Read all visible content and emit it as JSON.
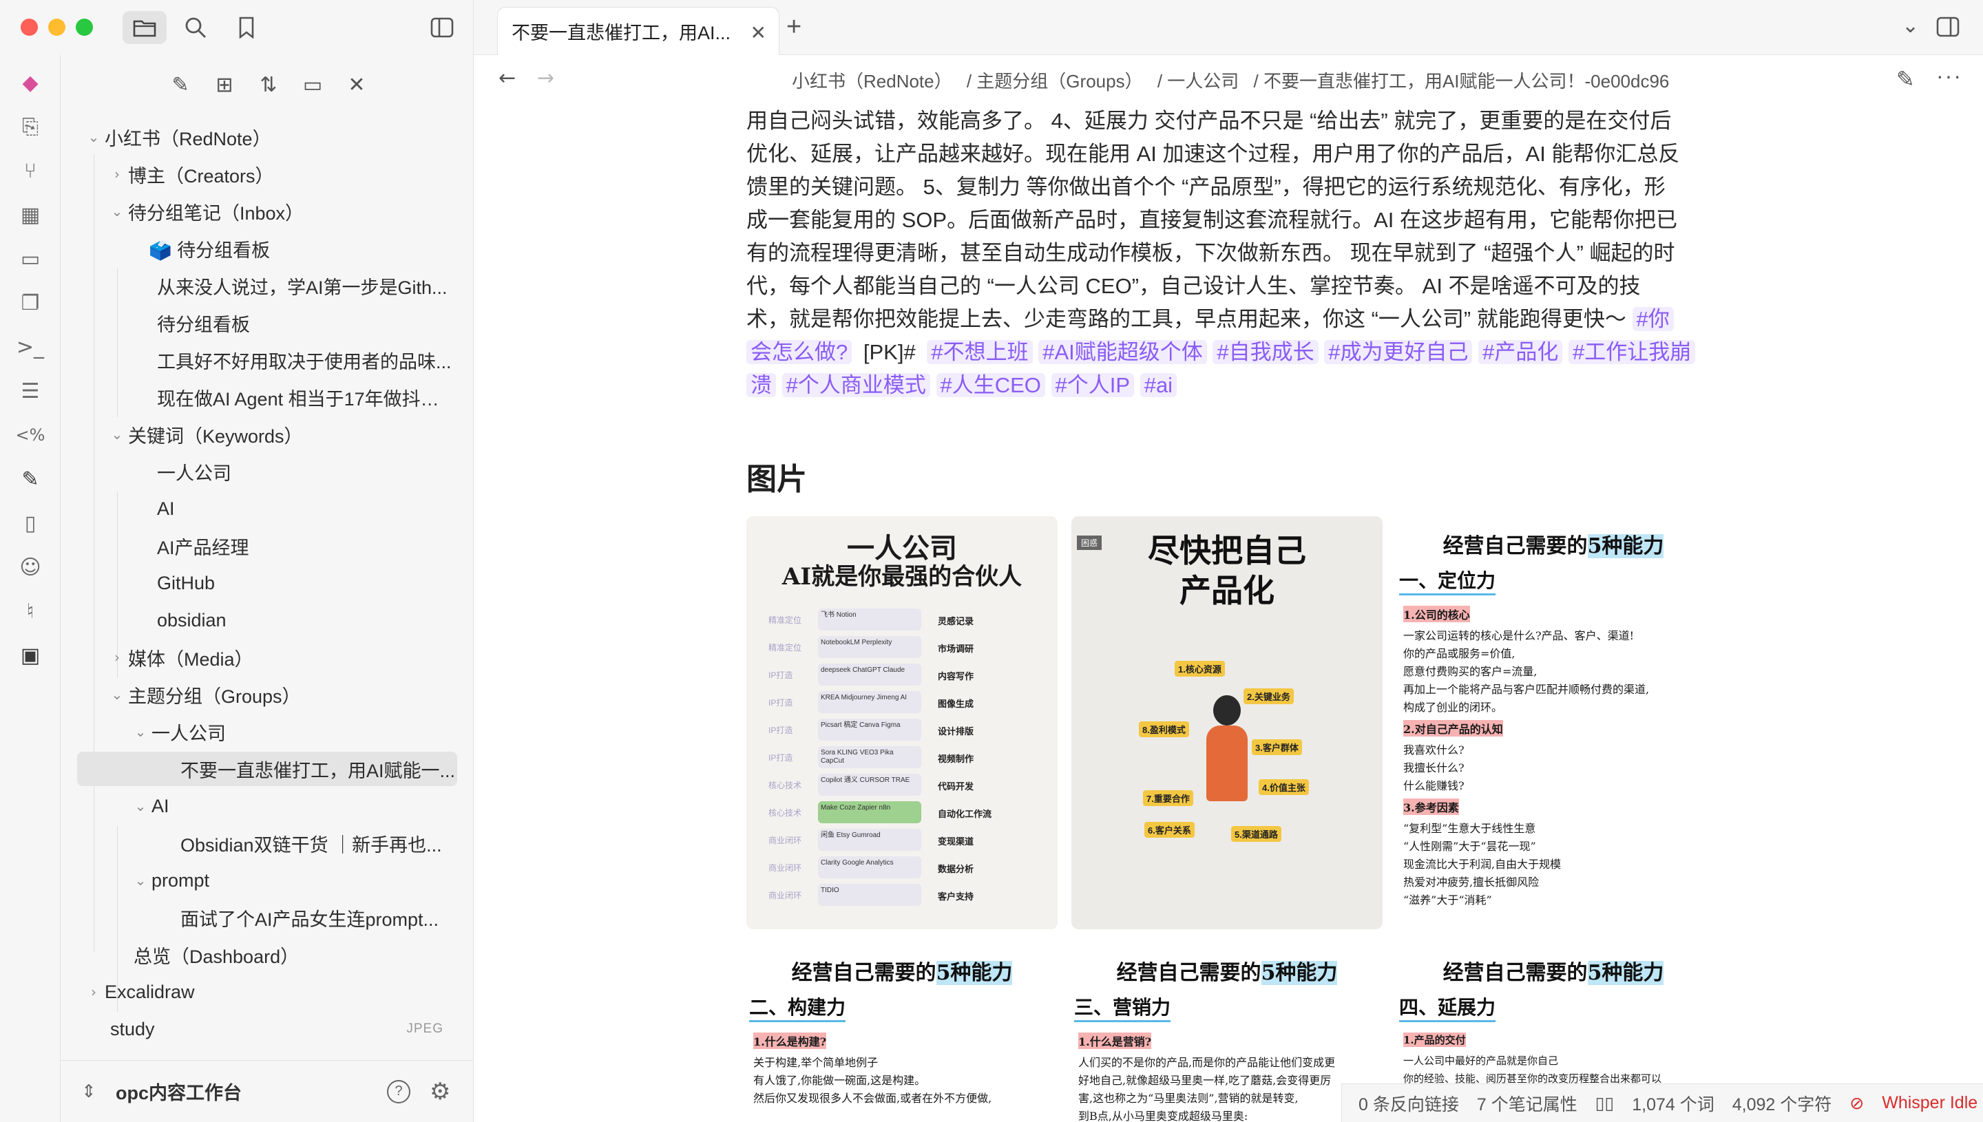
{
  "tab": {
    "title": "不要一直悲催打工，用AI..."
  },
  "breadcrumb": [
    "小红书（RedNote）",
    "/ 主题分组（Groups）",
    "/ 一人公司",
    "/ 不要一直悲催打工，用AI赋能一人公司！-0e00dc96"
  ],
  "sidebar": {
    "tree": [
      {
        "label": "小红书（RedNote）",
        "chev": "⌄"
      },
      {
        "label": "博主（Creators）",
        "chev": "›"
      },
      {
        "label": "待分组笔记（Inbox）",
        "chev": "⌄"
      },
      {
        "label": "🗳️ 待分组看板",
        "chev": ""
      },
      {
        "label": "从来没人说过，学AI第一步是Gith...",
        "chev": ""
      },
      {
        "label": "待分组看板",
        "chev": ""
      },
      {
        "label": "工具好不好用取决于使用者的品味...",
        "chev": ""
      },
      {
        "label": "现在做AI Agent 相当于17年做抖音...",
        "chev": ""
      },
      {
        "label": "关键词（Keywords）",
        "chev": "⌄"
      },
      {
        "label": "一人公司",
        "chev": ""
      },
      {
        "label": "AI",
        "chev": ""
      },
      {
        "label": "AI产品经理",
        "chev": ""
      },
      {
        "label": "GitHub",
        "chev": ""
      },
      {
        "label": "obsidian",
        "chev": ""
      },
      {
        "label": "媒体（Media）",
        "chev": "›"
      },
      {
        "label": "主题分组（Groups）",
        "chev": "⌄"
      },
      {
        "label": "一人公司",
        "chev": "⌄"
      },
      {
        "label": "不要一直悲催打工，用AI赋能一...",
        "chev": ""
      },
      {
        "label": "AI",
        "chev": "⌄"
      },
      {
        "label": "Obsidian双链干货 ｜新手再也...",
        "chev": ""
      },
      {
        "label": "prompt",
        "chev": "⌄"
      },
      {
        "label": "面试了个AI产品女生连prompt...",
        "chev": ""
      },
      {
        "label": "总览（Dashboard）",
        "chev": ""
      },
      {
        "label": "Excalidraw",
        "chev": "›"
      },
      {
        "label": "study",
        "chev": ""
      }
    ],
    "jpeg_badge": "JPEG",
    "vault_name": "opc内容工作台"
  },
  "note": {
    "body_lines": [
      "用自己闷头试错，效能高多了。 4、延展力 交付产品不只是 “给出去” 就完了，更重要的是在交付后",
      "优化、延展，让产品越来越好。现在能用 AI 加速这个过程，用户用了你的产品后，AI 能帮你汇总反",
      "馈里的关键问题。 5、复制力 等你做出首个个 “产品原型”，得把它的运行系统规范化、有序化，形",
      "成一套能复用的 SOP。后面做新产品时，直接复制这套流程就行。AI 在这步超有用，它能帮你把已",
      "有的流程理得更清晰，甚至自动生成动作模板，下次做新东西。 现在早就到了 “超强个人” 崛起的时",
      "代，每个人都能当自己的 “一人公司 CEO”，自己设计人生、掌控节奏。 AI 不是啥遥不可及的技",
      "术，就是帮你把效能提上去、少走弯路的工具，早点用起来，你这 “一人公司” 就能跑得更快～"
    ],
    "tag_first": "#你",
    "tag_line2_a": "会怎么做?",
    "pk_text": "[PK]#",
    "tags_line2": [
      "#不想上班",
      "#AI赋能超级个体",
      "#自我成长",
      "#成为更好自己",
      "#产品化",
      "#工作让我崩"
    ],
    "tags_line3": [
      "溃",
      "#个人商业模式",
      "#人生CEO",
      "#个人IP",
      "#ai"
    ],
    "section_title": "图片"
  },
  "cards": {
    "c1": {
      "title1": "一人公司",
      "title2": "AI就是你最强的合伙人",
      "rows": [
        {
          "l": "精准定位",
          "r": "灵感记录",
          "t": "飞书  Notion"
        },
        {
          "l": "精准定位",
          "r": "市场调研",
          "t": "NotebookLM Perplexity"
        },
        {
          "l": "IP打造",
          "r": "内容写作",
          "t": "deepseek ChatGPT Claude"
        },
        {
          "l": "IP打造",
          "r": "图像生成",
          "t": "KREA Midjourney Jimeng AI"
        },
        {
          "l": "IP打造",
          "r": "设计排版",
          "t": "Picsart 稿定 Canva Figma"
        },
        {
          "l": "IP打造",
          "r": "视频制作",
          "t": "Sora KLING VEO3 Pika CapCut"
        },
        {
          "l": "核心技术",
          "r": "代码开发",
          "t": "Copilot 通义 CURSOR TRAE"
        },
        {
          "l": "核心技术",
          "r": "自动化工作流",
          "t": "Make Coze Zapier n8n"
        },
        {
          "l": "商业闭环",
          "r": "变现渠道",
          "t": "闲鱼 Etsy Gumroad"
        },
        {
          "l": "商业闭环",
          "r": "数据分析",
          "t": "Clarity Google Analytics"
        },
        {
          "l": "商业闭环",
          "r": "客户支持",
          "t": "TIDIO"
        }
      ]
    },
    "c2": {
      "badge": "困惑",
      "title1": "尽快把自己",
      "title2": "产品化",
      "nodes": [
        "1.核心资源",
        "2.关键业务",
        "3.客户群体",
        "4.价值主张",
        "5.渠道通路",
        "6.客户关系",
        "7.重要合作",
        "8.盈利模式"
      ]
    },
    "c3": {
      "header": "经营自己需要的",
      "highlight": "5种能力",
      "section": "一、定位力",
      "items": [
        "1.公司的核心",
        "一家公司运转的核心是什么?产品、客户、渠道!",
        "你的产品或服务=价值,",
        "愿意付费购买的客户=流量,",
        "再加上一个能将产品与客户匹配并顺畅付费的渠道,",
        "构成了创业的闭环。",
        "2.对自己产品的认知",
        "我喜欢什么?",
        "我擅长什么?",
        "什么能赚钱?",
        "3.参考因素",
        "“复利型”生意大于线性生意",
        "“人性刚需”大于“昙花一现”",
        "现金流比大于利润,自由大于规模",
        "热爱对冲疲劳,擅长抵御风险",
        "“滋养”大于“消耗”"
      ]
    },
    "c4": {
      "header": "经营自己需要的",
      "highlight": "5种能力",
      "section": "二、构建力",
      "items": [
        "1.什么是构建?",
        "关于构建,举个简单地例子",
        "有人饿了,你能做一碗面,这是构建。",
        "然后你又发现很多人不会做面,或者在外不方便做,"
      ]
    },
    "c5": {
      "header": "经营自己需要的",
      "highlight": "5种能力",
      "section": "三、营销力",
      "items": [
        "1.什么是营销?",
        "人们买的不是你的产品,而是你的产品能让他们变成更",
        "好地自己,就像超级马里奥一样,吃了蘑菇,会变得更厉",
        "害,这也称之为“马里奥法则”,营销的就是转变,",
        "到B点,从小马里奥变成超级马里奥:"
      ]
    },
    "c6": {
      "header": "经营自己需要的",
      "highlight": "5种能力",
      "section": "四、延展力",
      "items": [
        "1.产品的交付",
        "一人公司中最好的产品就是你自己",
        "你的经验、技能、阅历甚至你的改变历程整合出来都可以"
      ]
    }
  },
  "status": {
    "backlinks": "0 条反向链接",
    "props": "7 个笔记属性",
    "words": "1,074 个词",
    "chars": "4,092 个字符",
    "whisper": "Whisper Idle"
  },
  "colors": {
    "accent": "#8a5cf5",
    "tag_bg": "#f1ecfe",
    "whisper": "#d92b2b"
  }
}
